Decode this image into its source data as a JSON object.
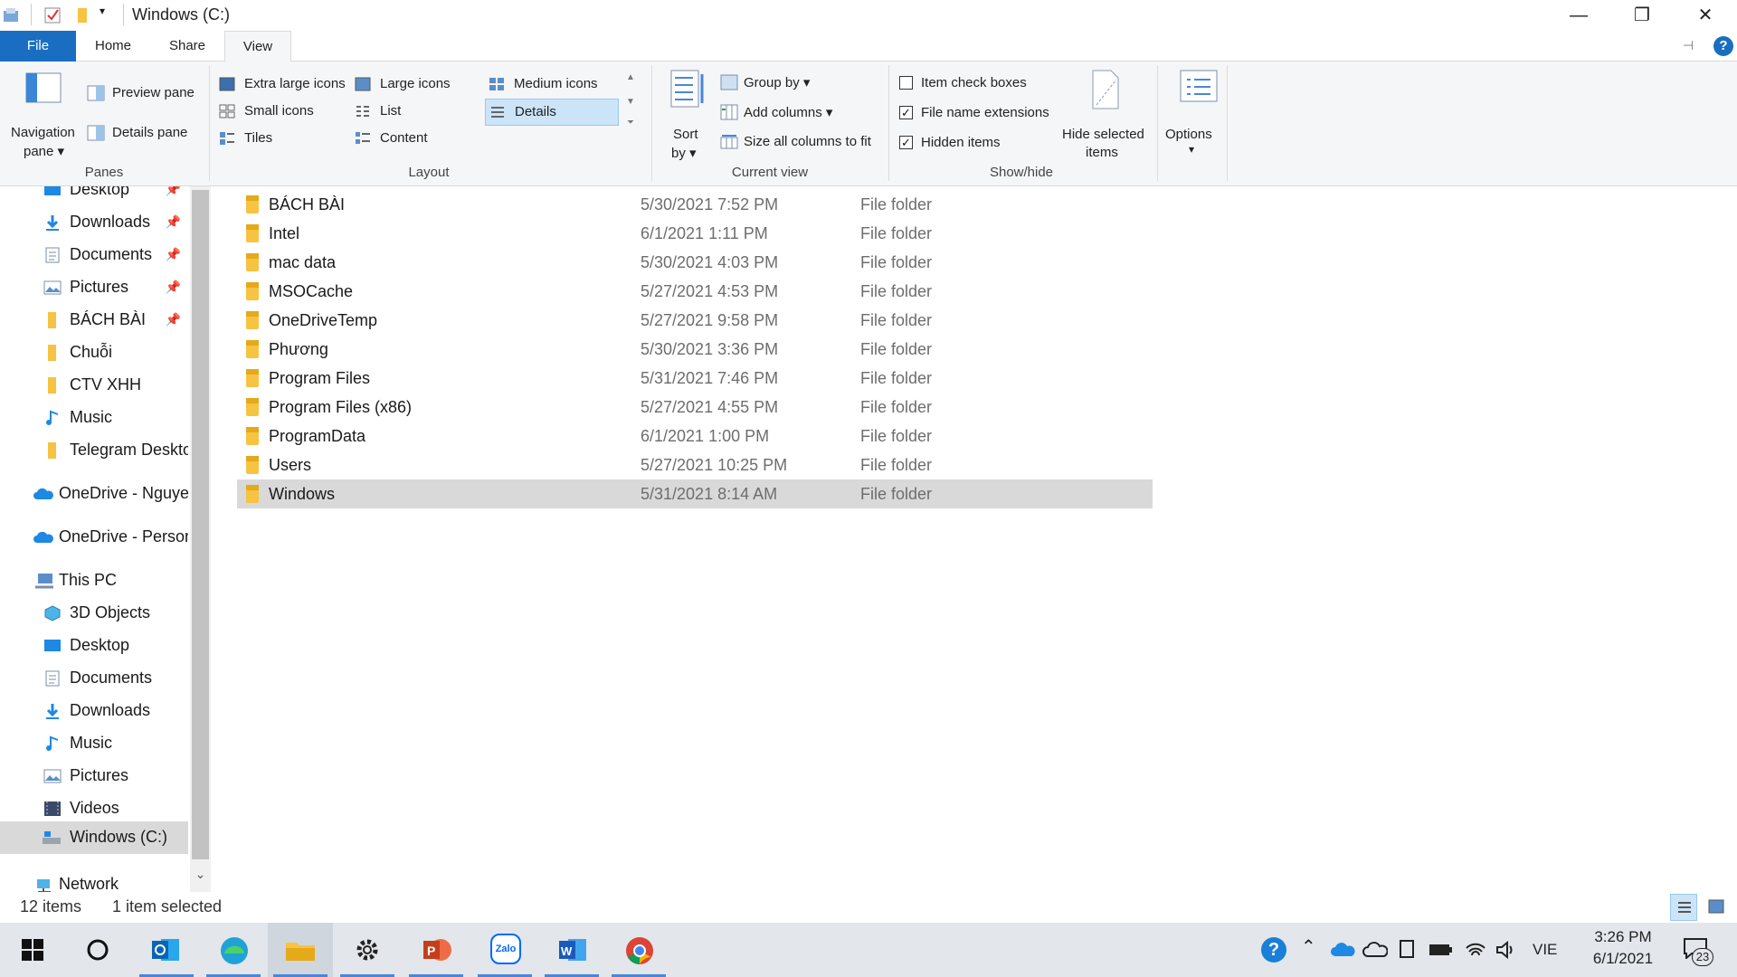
{
  "window": {
    "title": "Windows  (C:)",
    "controls": {
      "minimize": "—",
      "restore": "❐",
      "close": "✕"
    }
  },
  "ribbon_tabs": [
    "File",
    "Home",
    "Share",
    "View"
  ],
  "ribbon": {
    "panes": {
      "navigation_pane_line1": "Navigation",
      "navigation_pane_line2": "pane",
      "preview_pane": "Preview pane",
      "details_pane": "Details pane",
      "group_label": "Panes"
    },
    "layout": {
      "extra_large_icons": "Extra large icons",
      "large_icons": "Large icons",
      "medium_icons": "Medium icons",
      "small_icons": "Small icons",
      "list": "List",
      "details": "Details",
      "tiles": "Tiles",
      "content": "Content",
      "group_label": "Layout"
    },
    "current_view": {
      "sort_by_line1": "Sort",
      "sort_by_line2": "by",
      "group_by": "Group by",
      "add_columns": "Add columns",
      "size_all_columns": "Size all columns to fit",
      "group_label": "Current view"
    },
    "show_hide": {
      "item_check_boxes": "Item check boxes",
      "file_name_extensions": "File name extensions",
      "hidden_items": "Hidden items",
      "hide_selected_line1": "Hide selected",
      "hide_selected_line2": "items",
      "group_label": "Show/hide",
      "checks": {
        "item_check_boxes": "",
        "file_name_extensions": "✓",
        "hidden_items": "✓"
      }
    },
    "options": {
      "label": "Options"
    }
  },
  "nav": {
    "quick_access": [
      {
        "label": "Desktop",
        "pinned": "📌"
      },
      {
        "label": "Downloads",
        "pinned": "📌"
      },
      {
        "label": "Documents",
        "pinned": "📌"
      },
      {
        "label": "Pictures",
        "pinned": "📌"
      },
      {
        "label": "BÁCH BÀI",
        "pinned": "📌"
      },
      {
        "label": "Chuỗi"
      },
      {
        "label": "CTV XHH"
      },
      {
        "label": "Music"
      },
      {
        "label": "Telegram Desktop"
      }
    ],
    "onedrive_1": "OneDrive - Nguyen",
    "onedrive_2": "OneDrive - Personal",
    "this_pc": "This PC",
    "this_pc_items": [
      "3D Objects",
      "Desktop",
      "Documents",
      "Downloads",
      "Music",
      "Pictures",
      "Videos",
      "Windows  (C:)"
    ],
    "network": "Network"
  },
  "files": [
    {
      "name": "BÁCH BÀI",
      "date": "5/30/2021 7:52 PM",
      "type": "File folder"
    },
    {
      "name": "Intel",
      "date": "6/1/2021 1:11 PM",
      "type": "File folder"
    },
    {
      "name": "mac data",
      "date": "5/30/2021 4:03 PM",
      "type": "File folder"
    },
    {
      "name": "MSOCache",
      "date": "5/27/2021 4:53 PM",
      "type": "File folder"
    },
    {
      "name": "OneDriveTemp",
      "date": "5/27/2021 9:58 PM",
      "type": "File folder"
    },
    {
      "name": "Phương",
      "date": "5/30/2021 3:36 PM",
      "type": "File folder"
    },
    {
      "name": "Program Files",
      "date": "5/31/2021 7:46 PM",
      "type": "File folder"
    },
    {
      "name": "Program Files (x86)",
      "date": "5/27/2021 4:55 PM",
      "type": "File folder"
    },
    {
      "name": "ProgramData",
      "date": "6/1/2021 1:00 PM",
      "type": "File folder"
    },
    {
      "name": "Users",
      "date": "5/27/2021 10:25 PM",
      "type": "File folder"
    },
    {
      "name": "Windows",
      "date": "5/31/2021 8:14 AM",
      "type": "File folder"
    }
  ],
  "status": {
    "item_count": "12 items",
    "selected": "1 item selected"
  },
  "taskbar": {
    "apps": [
      "start",
      "search",
      "outlook",
      "edge",
      "file-explorer",
      "settings",
      "powerpoint",
      "zalo",
      "word",
      "chrome"
    ],
    "zalo_label": "Zalo",
    "language": "VIE",
    "time": "3:26 PM",
    "date": "6/1/2021",
    "notifications": "23"
  },
  "colors": {
    "accent": "#1a6ec2",
    "selection": "#d9d9d9",
    "folder": "#f6c342"
  }
}
